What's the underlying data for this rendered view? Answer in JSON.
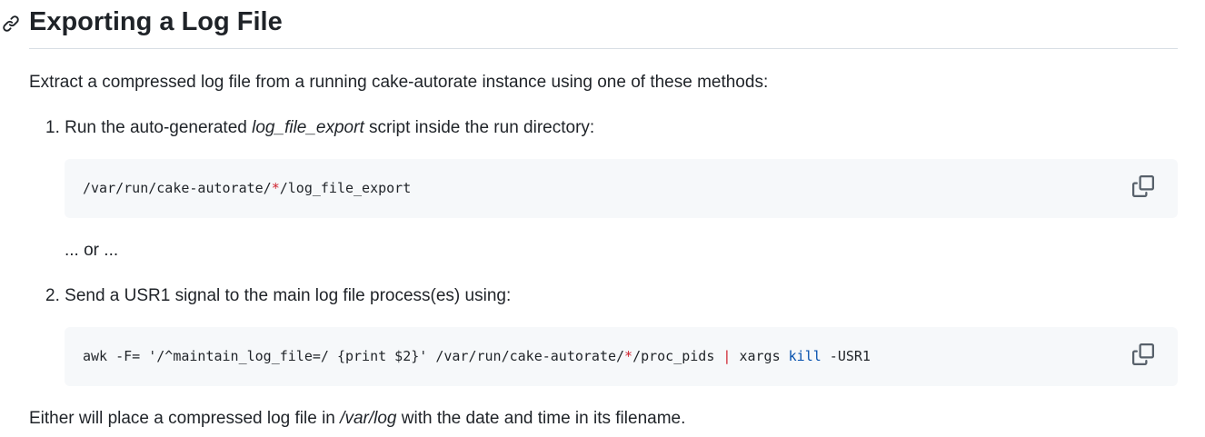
{
  "heading": {
    "title": "Exporting a Log File",
    "anchor_icon": "link-icon"
  },
  "intro": "Extract a compressed log file from a running cake-autorate instance using one of these methods:",
  "steps": [
    {
      "number": "1.",
      "text_before": "Run the auto-generated ",
      "emphasis": "log_file_export",
      "text_after": " script inside the run directory:",
      "code": {
        "part1": "/var/run/cake-autorate/",
        "glob": "*",
        "part2": "/log_file_export"
      },
      "copy_icon": "copy-icon"
    },
    {
      "number": "2.",
      "text": "Send a USR1 signal to the main log file process(es) using:",
      "code": {
        "part1": "awk -F= '/^maintain_log_file=/ {print $2}' /var/run/cake-autorate/",
        "glob": "*",
        "part2": "/proc_pids ",
        "pipe": "|",
        "part3": " xargs ",
        "kill": "kill",
        "part4": " -USR1"
      },
      "copy_icon": "copy-icon"
    }
  ],
  "separator": "... or ...",
  "outro": {
    "text_before": "Either will place a compressed log file in ",
    "emphasis": "/var/log",
    "text_after": " with the date and time in its filename."
  },
  "colors": {
    "text": "#1f2328",
    "code_bg": "#f6f8fa",
    "operator": "#cf222e",
    "builtin": "#0550ae",
    "rule": "#d8dee4"
  }
}
